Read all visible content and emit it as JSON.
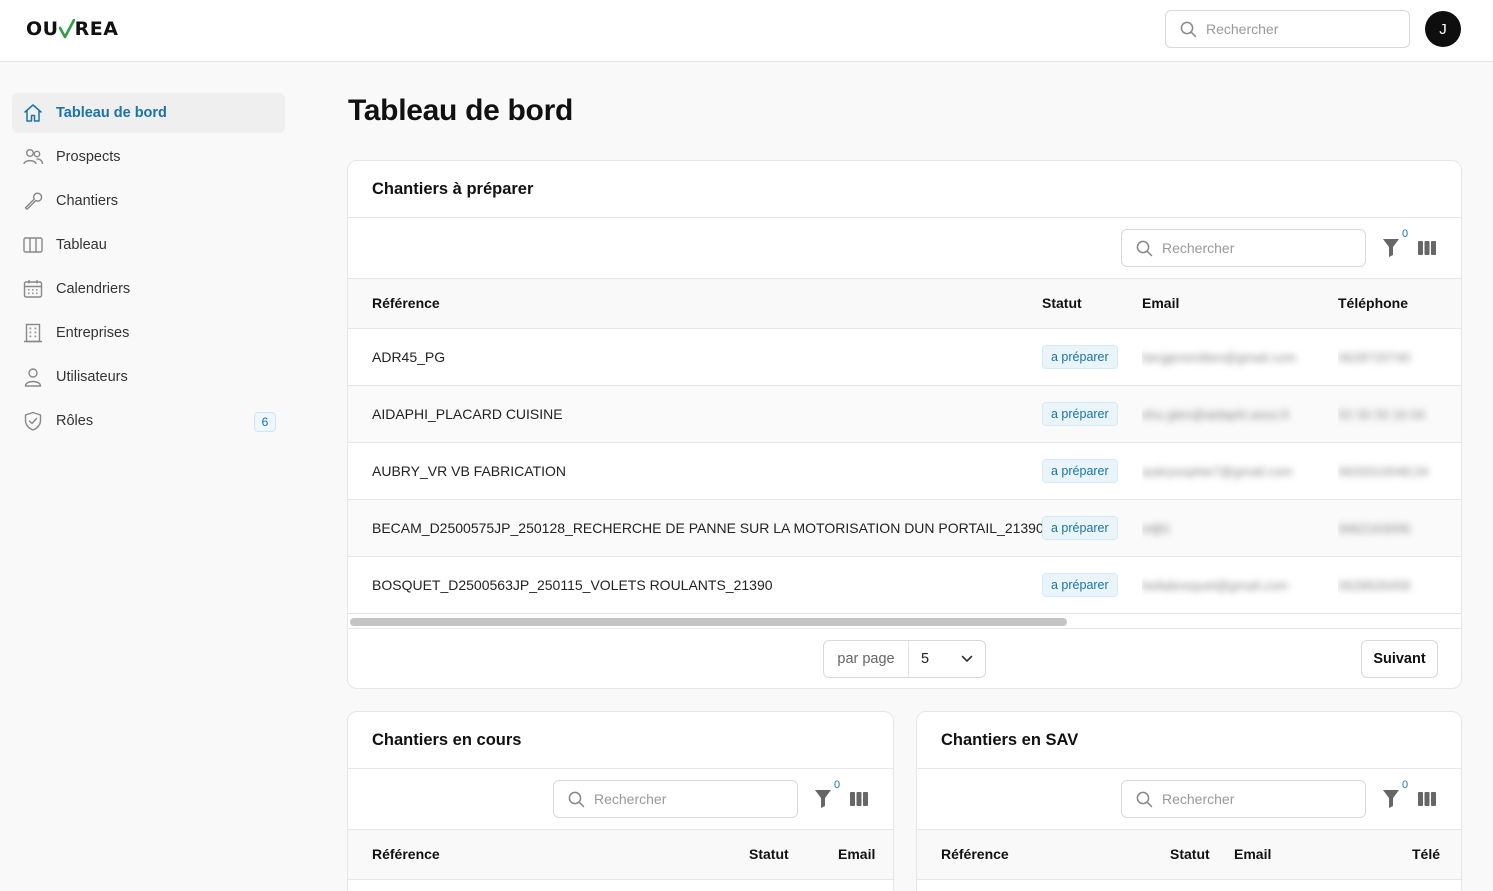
{
  "header": {
    "logo_left": "OU",
    "logo_right": "REA",
    "search_placeholder": "Rechercher",
    "avatar_initial": "J"
  },
  "sidebar": {
    "items": [
      {
        "label": "Tableau de bord",
        "icon": "home-icon",
        "active": true
      },
      {
        "label": "Prospects",
        "icon": "users-icon"
      },
      {
        "label": "Chantiers",
        "icon": "wrench-icon"
      },
      {
        "label": "Tableau",
        "icon": "columns-icon"
      },
      {
        "label": "Calendriers",
        "icon": "calendar-icon"
      },
      {
        "label": "Entreprises",
        "icon": "building-icon"
      },
      {
        "label": "Utilisateurs",
        "icon": "user-icon"
      },
      {
        "label": "Rôles",
        "icon": "shield-icon",
        "badge": "6"
      }
    ]
  },
  "page": {
    "title": "Tableau de bord"
  },
  "chantiers_a_preparer": {
    "title": "Chantiers à préparer",
    "search_placeholder": "Rechercher",
    "filter_count": "0",
    "columns": [
      "Référence",
      "Statut",
      "Email",
      "Téléphone"
    ],
    "rows": [
      {
        "ref": "ADR45_PG",
        "status": "a préparer",
        "email": "bergjeremilien@gmail.com",
        "phone": "0628720740"
      },
      {
        "ref": "AIDAPHI_PLACARD CUISINE",
        "status": "a préparer",
        "email": "ehu.glen@aidaphi.asso.fr",
        "phone": "02 33 33 16 04"
      },
      {
        "ref": "AUBRY_VR VB FABRICATION",
        "status": "a préparer",
        "email": "aubrysophie7@gmail.com",
        "phone": "0633310048,04"
      },
      {
        "ref": "BECAM_D2500575JP_250128_RECHERCHE DE PANNE SUR LA MOTORISATION DUN PORTAIL_21390",
        "status": "a préparer",
        "email": "edjhi",
        "phone": "0662163006"
      },
      {
        "ref": "BOSQUET_D2500563JP_250115_VOLETS ROULANTS_21390",
        "status": "a préparer",
        "email": "bellabosquet@gmail.com",
        "phone": "0628926458"
      }
    ],
    "per_page_label": "par page",
    "per_page_value": "5",
    "next_label": "Suivant"
  },
  "chantiers_en_cours": {
    "title": "Chantiers en cours",
    "search_placeholder": "Rechercher",
    "filter_count": "0",
    "columns": [
      "Référence",
      "Statut",
      "Email"
    ]
  },
  "chantiers_en_sav": {
    "title": "Chantiers en SAV",
    "search_placeholder": "Rechercher",
    "filter_count": "0",
    "columns": [
      "Référence",
      "Statut",
      "Email",
      "Télé"
    ]
  },
  "colors": {
    "accent": "#1a73a8",
    "logo_check": "#2e9c4a",
    "pill_bg": "#eaf4fb"
  }
}
